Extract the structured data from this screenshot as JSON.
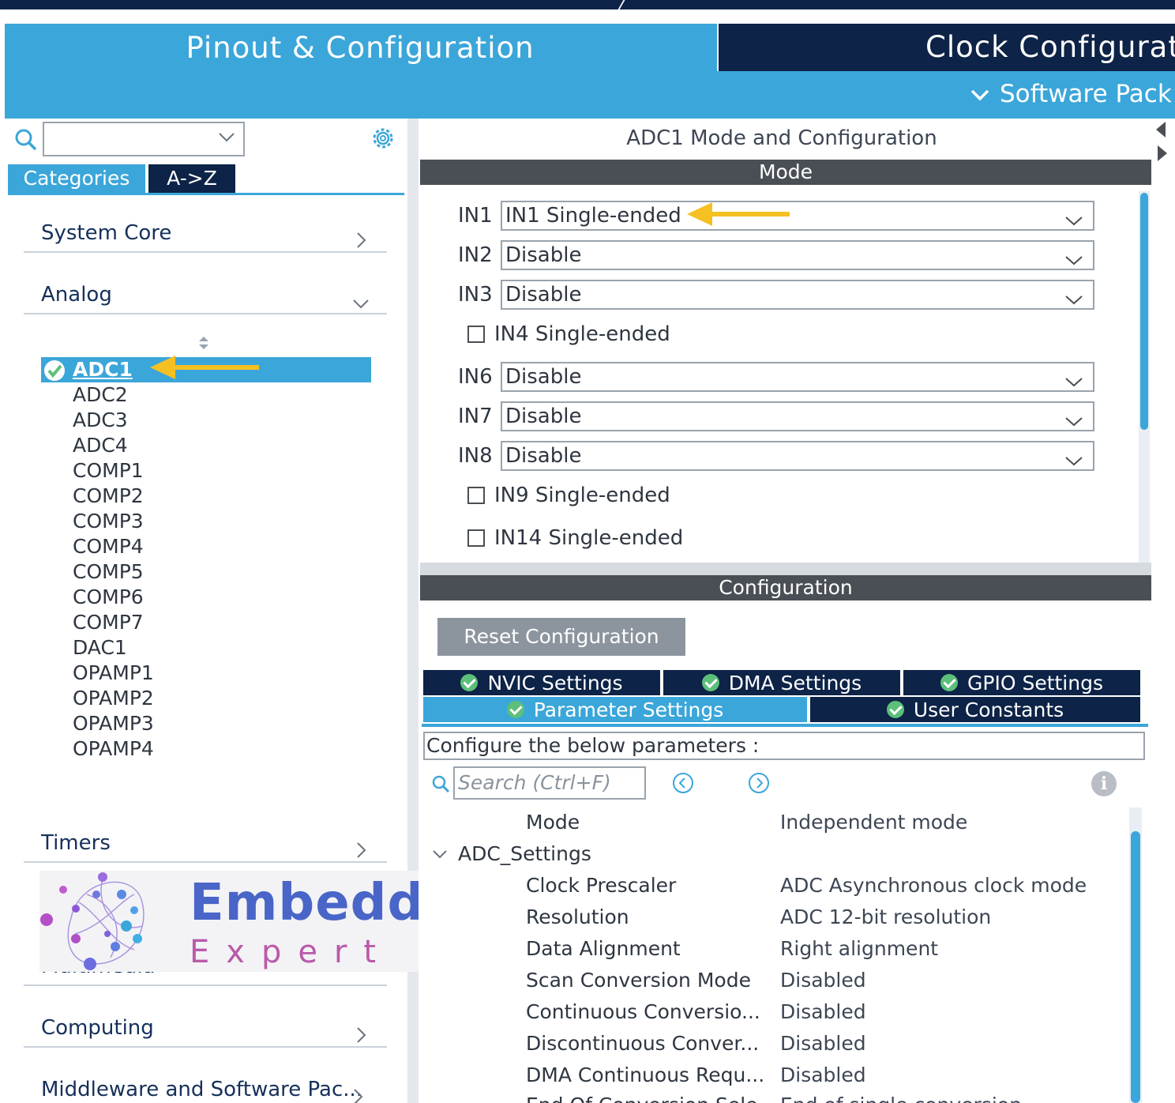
{
  "header": {
    "tabs": [
      {
        "label": "Pinout & Configuration"
      },
      {
        "label": "Clock Configurati"
      }
    ],
    "software_packs_label": "Software Pack"
  },
  "left": {
    "search": {
      "value": ""
    },
    "tabs": {
      "categories": "Categories",
      "az": "A->Z"
    },
    "categories": {
      "system_core": "System Core",
      "analog": "Analog",
      "timers": "Timers",
      "multimedia": "Multimedia",
      "computing": "Computing",
      "middleware": "Middleware and Software Pac..."
    },
    "analog_items": [
      "ADC1",
      "ADC2",
      "ADC3",
      "ADC4",
      "COMP1",
      "COMP2",
      "COMP3",
      "COMP4",
      "COMP5",
      "COMP6",
      "COMP7",
      "DAC1",
      "OPAMP1",
      "OPAMP2",
      "OPAMP3",
      "OPAMP4"
    ],
    "selected_item": "ADC1"
  },
  "watermark": {
    "main": "Embedded",
    "sub": "Expert IO"
  },
  "right": {
    "title": "ADC1 Mode and Configuration",
    "mode_header": "Mode",
    "mode_rows": [
      {
        "label": "IN1",
        "value": "IN1 Single-ended"
      },
      {
        "label": "IN2",
        "value": "Disable"
      },
      {
        "label": "IN3",
        "value": "Disable"
      },
      {
        "check": "IN4 Single-ended",
        "checked": false
      },
      {
        "label": "IN6",
        "value": "Disable"
      },
      {
        "label": "IN7",
        "value": "Disable"
      },
      {
        "label": "IN8",
        "value": "Disable"
      },
      {
        "check": "IN9 Single-ended",
        "checked": false
      },
      {
        "check": "IN14 Single-ended",
        "checked": false
      }
    ],
    "config_header": "Configuration",
    "reset_button": "Reset Configuration",
    "config_tabs": {
      "nvic": "NVIC Settings",
      "dma": "DMA Settings",
      "gpio": "GPIO Settings",
      "parameter": "Parameter Settings",
      "user": "User Constants"
    },
    "param_header": "Configure the below parameters :",
    "param_search_placeholder": "Search (Ctrl+F)",
    "info_glyph": "i",
    "params": {
      "mode": {
        "name": "Mode",
        "value": "Independent mode"
      },
      "group": "ADC_Settings",
      "rows": [
        {
          "name": "Clock Prescaler",
          "value": "ADC Asynchronous clock mode"
        },
        {
          "name": "Resolution",
          "value": "ADC 12-bit resolution"
        },
        {
          "name": "Data Alignment",
          "value": "Right alignment"
        },
        {
          "name": "Scan Conversion Mode",
          "value": "Disabled"
        },
        {
          "name": "Continuous Conversio...",
          "value": "Disabled"
        },
        {
          "name": "Discontinuous Conver...",
          "value": "Disabled"
        },
        {
          "name": "DMA Continuous Requ...",
          "value": "Disabled"
        },
        {
          "name": "End Of Conversion Sele...",
          "value": "End of single conversion"
        }
      ]
    }
  },
  "colors": {
    "accent": "#3ba6d9",
    "navy": "#0d2347",
    "bar": "#4a4f55",
    "arrow": "#f5c022",
    "check": "#5cbf7a"
  }
}
